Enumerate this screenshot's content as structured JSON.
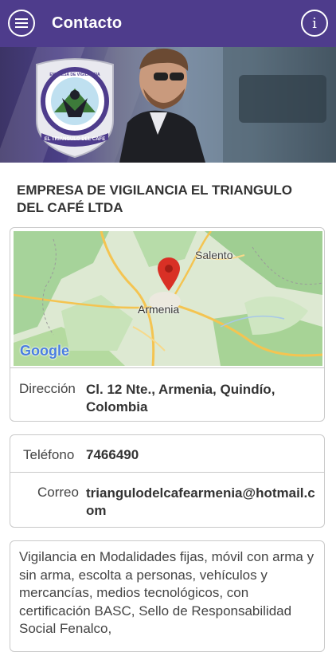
{
  "appbar": {
    "title": "Contacto",
    "menu_icon": "hamburger-menu-icon",
    "info_icon": "info-icon",
    "info_glyph": "i"
  },
  "banner": {
    "logo_top_text": "EMPRESA DE VIGILANCIA",
    "logo_bottom_text": "EL TRIANGULO DEL CAFE"
  },
  "company": {
    "name": "EMPRESA DE VIGILANCIA EL TRIANGULO DEL CAFÉ LTDA"
  },
  "map": {
    "labels": {
      "city": "Armenia",
      "town": "Salento",
      "brand": "Google"
    },
    "pin_icon": "map-pin-icon"
  },
  "address": {
    "label": "Dirección",
    "value": "Cl. 12 Nte., Armenia, Quindío, Colombia"
  },
  "phone": {
    "label": "Teléfono",
    "value": "7466490"
  },
  "email": {
    "label": "Correo",
    "value": "triangulodelcafearmenia@hotmail.com"
  },
  "description": "Vigilancia en Modalidades fijas, móvil con arma y sin arma, escolta a personas, vehículos y mercancías, medios tecnológicos, con certificación BASC, Sello de Responsabilidad Social Fenalco,",
  "colors": {
    "appbar": "#4e3c8c",
    "border": "#c9c9c9",
    "map_pin": "#d93025"
  }
}
